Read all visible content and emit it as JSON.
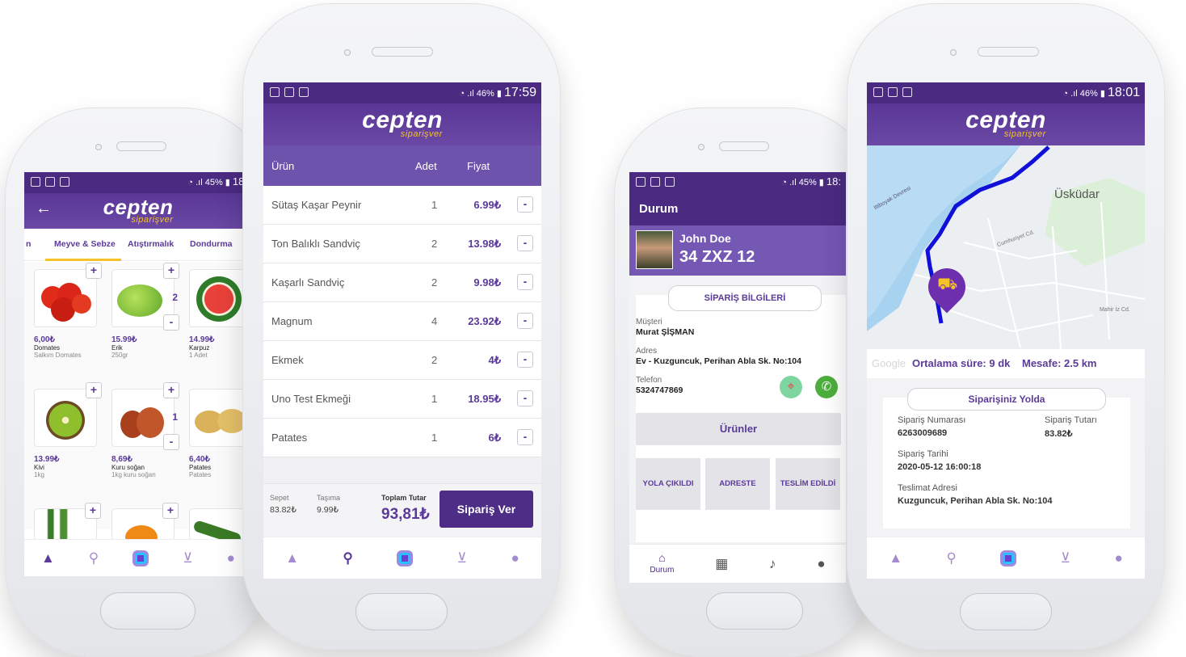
{
  "brand": {
    "logo": "cepten",
    "tagline": "siparişver",
    "accent": "#5b3a99",
    "yellow": "#f6c229"
  },
  "phone1": {
    "status": {
      "battery": "45%",
      "time": "18:"
    },
    "back_icon": "arrow-left-icon",
    "tabs": [
      "n",
      "Meyve & Sebze",
      "Atıştırmalık",
      "Dondurma"
    ],
    "products": [
      {
        "price": "6,00₺",
        "name": "Domates",
        "desc": "Salkım Domates",
        "qty": ""
      },
      {
        "price": "15.99₺",
        "name": "Erik",
        "desc": "250gr",
        "qty": "2"
      },
      {
        "price": "14.99₺",
        "name": "Karpuz",
        "desc": "1 Adet",
        "qty": ""
      },
      {
        "price": "13.99₺",
        "name": "Kivi",
        "desc": "1kg",
        "qty": ""
      },
      {
        "price": "8,69₺",
        "name": "Kuru soğan",
        "desc": "1kg kuru soğan",
        "qty": "1"
      },
      {
        "price": "6,40₺",
        "name": "Patates",
        "desc": "Patates",
        "qty": ""
      }
    ]
  },
  "phone2": {
    "status": {
      "battery": "46%",
      "time": "17:59"
    },
    "table_headers": {
      "product": "Ürün",
      "qty": "Adet",
      "price": "Fiyat"
    },
    "rows": [
      {
        "name": "Sütaş Kaşar Peynir",
        "qty": "1",
        "price": "6.99₺"
      },
      {
        "name": "Ton Balıklı Sandviç",
        "qty": "2",
        "price": "13.98₺"
      },
      {
        "name": "Kaşarlı Sandviç",
        "qty": "2",
        "price": "9.98₺"
      },
      {
        "name": "Magnum",
        "qty": "4",
        "price": "23.92₺"
      },
      {
        "name": "Ekmek",
        "qty": "2",
        "price": "4₺"
      },
      {
        "name": "Uno Test Ekmeği",
        "qty": "1",
        "price": "18.95₺"
      },
      {
        "name": "Patates",
        "qty": "1",
        "price": "6₺"
      }
    ],
    "minus": "-",
    "footer": {
      "sepet_label": "Sepet",
      "sepet_value": "83.82₺",
      "tasima_label": "Taşıma",
      "tasima_value": "9.99₺",
      "total_label": "Toplam Tutar",
      "total_value": "93,81₺",
      "order_button": "Sipariş Ver"
    }
  },
  "phone3": {
    "status": {
      "battery": "45%",
      "time": "18:"
    },
    "title": "Durum",
    "driver_name": "John Doe",
    "plate": "34 ZXZ 12",
    "info_button": "SİPARİŞ BİLGİLERİ",
    "customer_label": "Müşteri",
    "customer_value": "Murat ŞİŞMAN",
    "address_label": "Adres",
    "address_value": "Ev - Kuzguncuk, Perihan Abla Sk. No:104",
    "phone_label": "Telefon",
    "phone_value": "5324747869",
    "products_button": "Ürünler",
    "status_buttons": [
      "YOLA ÇIKILDI",
      "ADRESTE",
      "TESLİM EDİLDİ"
    ],
    "nav_label": "Durum"
  },
  "phone4": {
    "status": {
      "battery": "46%",
      "time": "18:01"
    },
    "map_labels": {
      "district": "Üsküdar",
      "road1": "Cumhuriyet Cd.",
      "road2": "Mahir İz Cd.",
      "road3": "Iltiboyak Devresi",
      "google": "Google"
    },
    "eta": "Ortalama süre: 9 dk",
    "distance": "Mesafe: 2.5 km",
    "card_title": "Siparişiniz Yolda",
    "order_no_label": "Sipariş Numarası",
    "order_no": "6263009689",
    "order_total_label": "Sipariş Tutarı",
    "order_total": "83.82₺",
    "date_label": "Sipariş Tarihi",
    "date": "2020-05-12 16:00:18",
    "address_label": "Teslimat Adresi",
    "address": "Kuzguncuk, Perihan Abla Sk. No:104"
  }
}
